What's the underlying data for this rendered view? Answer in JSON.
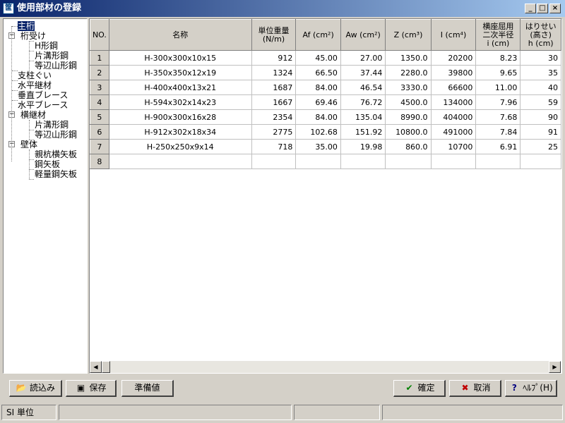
{
  "window": {
    "title": "使用部材の登録",
    "app_icon": "筐",
    "min_label": "_",
    "max_label": "□",
    "close_label": "×"
  },
  "tree": {
    "items": [
      {
        "label": "主桁",
        "selected": true
      },
      {
        "label": "桁受け",
        "expander": "−"
      },
      {
        "label": "H形鋼"
      },
      {
        "label": "片溝形鋼"
      },
      {
        "label": "等辺山形鋼"
      },
      {
        "label": "支柱ぐい"
      },
      {
        "label": "水平継材"
      },
      {
        "label": "垂直ブレース"
      },
      {
        "label": "水平ブレース"
      },
      {
        "label": "横継材",
        "expander": "−"
      },
      {
        "label": "片溝形鋼"
      },
      {
        "label": "等辺山形鋼"
      },
      {
        "label": "壁体",
        "expander": "−"
      },
      {
        "label": "親杭横矢板"
      },
      {
        "label": "鋼矢板"
      },
      {
        "label": "軽量鋼矢板"
      }
    ]
  },
  "grid": {
    "columns": [
      "NO.",
      "名称",
      "単位重量\n(N/m)",
      "Af (cm²)",
      "Aw (cm²)",
      "Z (cm³)",
      "I (cm⁴)",
      "横座屈用\n二次半径\ni (cm)",
      "はりせい\n(高さ)\nh (cm)"
    ],
    "rows": [
      [
        "1",
        "H-300x300x10x15",
        "912",
        "45.00",
        "27.00",
        "1350.0",
        "20200",
        "8.23",
        "30"
      ],
      [
        "2",
        "H-350x350x12x19",
        "1324",
        "66.50",
        "37.44",
        "2280.0",
        "39800",
        "9.65",
        "35"
      ],
      [
        "3",
        "H-400x400x13x21",
        "1687",
        "84.00",
        "46.54",
        "3330.0",
        "66600",
        "11.00",
        "40"
      ],
      [
        "4",
        "H-594x302x14x23",
        "1667",
        "69.46",
        "76.72",
        "4500.0",
        "134000",
        "7.96",
        "59"
      ],
      [
        "5",
        "H-900x300x16x28",
        "2354",
        "84.00",
        "135.04",
        "8990.0",
        "404000",
        "7.68",
        "90"
      ],
      [
        "6",
        "H-912x302x18x34",
        "2775",
        "102.68",
        "151.92",
        "10800.0",
        "491000",
        "7.84",
        "91"
      ],
      [
        "7",
        "H-250x250x9x14",
        "718",
        "35.00",
        "19.98",
        "860.0",
        "10700",
        "6.91",
        "25"
      ],
      [
        "8",
        "",
        "",
        "",
        "",
        "",
        "",
        "",
        ""
      ]
    ]
  },
  "scrollbar": {
    "left_arrow": "◀",
    "right_arrow": "▶"
  },
  "buttons": {
    "load": "読込み",
    "save": "保存",
    "defaults": "準備値",
    "ok": "確定",
    "cancel": "取消",
    "help": "ﾍﾙﾌﾟ(H)"
  },
  "icons": {
    "load": "open-folder-icon",
    "save": "floppy-disk-icon",
    "ok": "checkmark-icon",
    "cancel": "x-mark-icon",
    "help": "question-mark-icon"
  },
  "icon_glyphs": {
    "load": "📂",
    "save": "▣",
    "ok": "✔",
    "cancel": "✖",
    "help": "?"
  },
  "colors": {
    "ok_icon": "#008000",
    "cancel_icon": "#c00000",
    "help_icon": "#000080"
  },
  "status": {
    "units": "SI 単位"
  }
}
